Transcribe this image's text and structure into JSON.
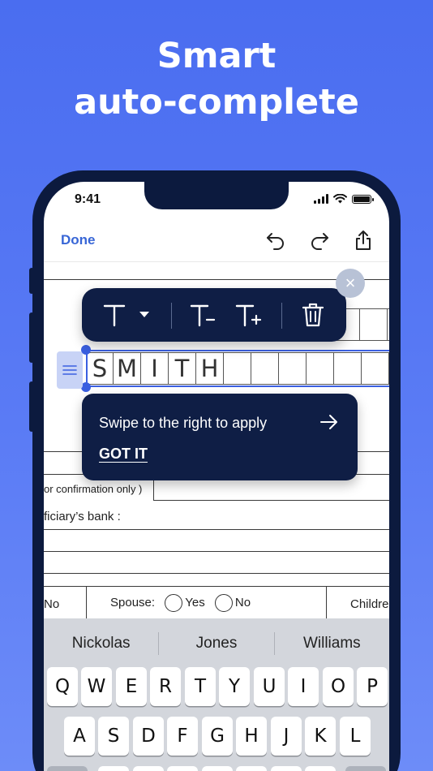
{
  "headline": {
    "line1": "Smart",
    "line2": "auto-complete"
  },
  "status_bar": {
    "time": "9:41"
  },
  "nav": {
    "done_label": "Done"
  },
  "field_top": {
    "cells": [
      "",
      "",
      ""
    ]
  },
  "field_name": {
    "cells": [
      "S",
      "M",
      "I",
      "T",
      "H",
      "",
      "",
      "",
      "",
      "",
      "",
      ""
    ]
  },
  "form": {
    "confirmation_text": "or confirmation only )",
    "bank_text": "ficiary’s bank :",
    "no_label": "No",
    "spouse_label": "Spouse:",
    "yes_label": "Yes",
    "no2_label": "No",
    "children_label": "Childre"
  },
  "tooltip": {
    "message": "Swipe to the right to apply",
    "dismiss_label": "GOT IT"
  },
  "suggestions": [
    "Nickolas",
    "Jones",
    "Williams"
  ],
  "keyboard": {
    "row1": [
      "Q",
      "W",
      "E",
      "R",
      "T",
      "Y",
      "U",
      "I",
      "O",
      "P"
    ],
    "row2": [
      "A",
      "S",
      "D",
      "F",
      "G",
      "H",
      "J",
      "K",
      "L"
    ]
  },
  "colors": {
    "background": "#4a6df0",
    "accent": "#3866d6",
    "toolbar": "#0f1e45"
  }
}
